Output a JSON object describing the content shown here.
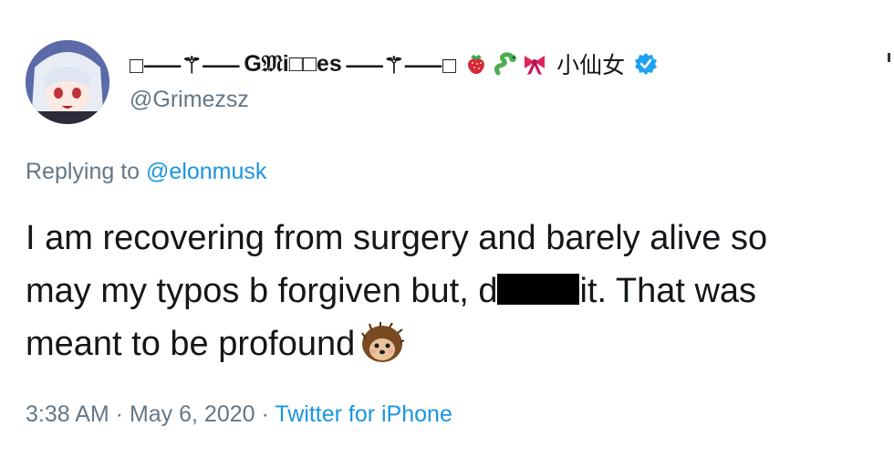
{
  "tweet": {
    "display_name": {
      "prefix_glyphs": "□⸺⚚⸺ ",
      "name": "G𝔐i□□es",
      "suffix_glyphs": " ⸺⚚⸺□",
      "cjk": "小仙女",
      "emojis": [
        "strawberry-icon",
        "snake-icon",
        "ribbon-icon"
      ]
    },
    "handle": "@Grimezsz",
    "reply": {
      "prefix": "Replying to ",
      "mention": "@elonmusk"
    },
    "body": {
      "line1": "I am recovering from surgery and barely alive so",
      "line2_before": "may my typos b forgiven but, d",
      "line2_after": "it.  That was",
      "line3": "meant to be profound"
    },
    "meta": {
      "time": "3:38 AM",
      "sep1": " · ",
      "date": "May 6, 2020",
      "sep2": " · ",
      "source": "Twitter for iPhone"
    },
    "colors": {
      "text": "#14171a",
      "muted": "#657786",
      "link": "#1b95e0",
      "verified": "#1da1f2"
    }
  }
}
